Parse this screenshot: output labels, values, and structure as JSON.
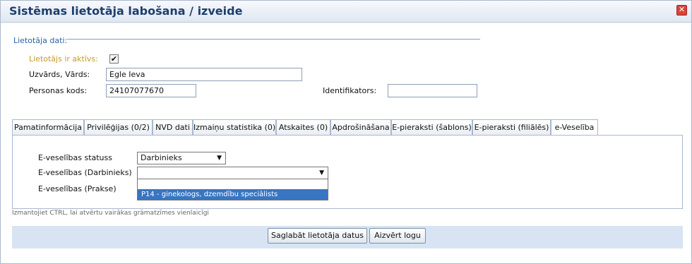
{
  "dialog": {
    "title": "Sistēmas lietotāja labošana / izveide",
    "close_icon": "close-icon"
  },
  "user_section": {
    "legend": "Lietotāja dati:",
    "active_label": "Lietotājs ir aktīvs:",
    "active_checked": true,
    "name_label": "Uzvārds, Vārds:",
    "name_value": "Egle Ieva",
    "personal_code_label": "Personas kods:",
    "personal_code_value": "24107077670",
    "identifier_label": "Identifikators:",
    "identifier_value": ""
  },
  "tabs": [
    {
      "label": "Pamatinformācija"
    },
    {
      "label": "Privilēģijas (0/2)"
    },
    {
      "label": "NVD dati"
    },
    {
      "label": "Izmaiņu statistika (0)"
    },
    {
      "label": "Atskaites (0)"
    },
    {
      "label": "Apdrošināšana"
    },
    {
      "label": "E-pieraksti (šablons)"
    },
    {
      "label": "E-pieraksti (filiālēs)"
    },
    {
      "label": "e-Veselība",
      "active": true
    }
  ],
  "eveseliba": {
    "status_label": "E-veselības statuss",
    "status_value": "Darbinieks",
    "employee_label": "E-veselības (Darbinieks)",
    "employee_value": "",
    "practice_label": "E-veselības (Prakse)",
    "dropdown_options": [
      "",
      "P14 - ginekologs, dzemdību speciālists"
    ],
    "dropdown_selected": "P14 - ginekologs, dzemdību speciālists"
  },
  "hint": "Izmantojiet CTRL, lai atvērtu vairākas grāmatzīmes vienlaicīgi",
  "footer": {
    "save_label": "Saglabāt lietotāja datus",
    "close_label": "Aizvērt logu"
  },
  "colors": {
    "title": "#1e3e6c",
    "legend": "#2a62a6",
    "active_label": "#c79a28",
    "selected_option": "#3875c2",
    "footer_bg": "#d8e4f3"
  }
}
